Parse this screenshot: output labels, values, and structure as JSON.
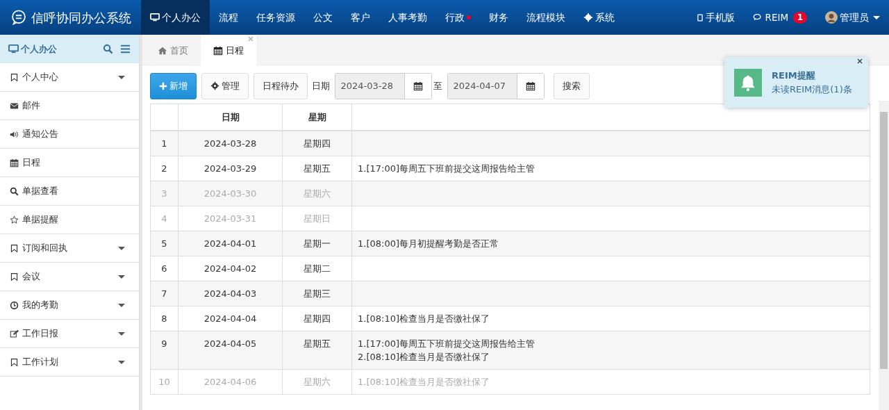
{
  "app": {
    "title": "信呼协同办公系统"
  },
  "top_nav": [
    {
      "label": "个人办公",
      "selected": true,
      "dot": false
    },
    {
      "label": "流程",
      "selected": false,
      "dot": false
    },
    {
      "label": "任务资源",
      "selected": false,
      "dot": false
    },
    {
      "label": "公文",
      "selected": false,
      "dot": false
    },
    {
      "label": "客户",
      "selected": false,
      "dot": false
    },
    {
      "label": "人事考勤",
      "selected": false,
      "dot": false
    },
    {
      "label": "行政",
      "selected": false,
      "dot": true
    },
    {
      "label": "财务",
      "selected": false,
      "dot": false
    },
    {
      "label": "流程模块",
      "selected": false,
      "dot": false
    },
    {
      "label": "系统",
      "selected": false,
      "dot": false
    }
  ],
  "top_right": {
    "mobile": "手机版",
    "reim": "REIM",
    "reim_badge": "1",
    "user": "管理员"
  },
  "sidebar": {
    "title": "个人办公",
    "items": [
      {
        "label": "个人中心",
        "expandable": true
      },
      {
        "label": "邮件",
        "expandable": false
      },
      {
        "label": "通知公告",
        "expandable": false
      },
      {
        "label": "日程",
        "expandable": false
      },
      {
        "label": "单据查看",
        "expandable": false
      },
      {
        "label": "单据提醒",
        "expandable": false
      },
      {
        "label": "订阅和回执",
        "expandable": true
      },
      {
        "label": "会议",
        "expandable": true
      },
      {
        "label": "我的考勤",
        "expandable": true
      },
      {
        "label": "工作日报",
        "expandable": true
      },
      {
        "label": "工作计划",
        "expandable": true
      }
    ]
  },
  "page_tabs": [
    {
      "label": "首页",
      "selected": false,
      "closable": false
    },
    {
      "label": "日程",
      "selected": true,
      "closable": true
    }
  ],
  "toolbar": {
    "add": "新增",
    "manage": "管理",
    "todo": "日程待办",
    "date_label": "日期",
    "date_from": "2024-03-28",
    "to_label": "至",
    "date_to": "2024-04-07",
    "search": "搜索"
  },
  "table": {
    "columns": [
      "日期",
      "星期"
    ],
    "rows": [
      {
        "index": "1",
        "date": "2024-03-28",
        "weekday": "星期四",
        "weekend": false,
        "events": []
      },
      {
        "index": "2",
        "date": "2024-03-29",
        "weekday": "星期五",
        "weekend": false,
        "events": [
          "1.[17:00]每周五下班前提交这周报告给主管"
        ]
      },
      {
        "index": "3",
        "date": "2024-03-30",
        "weekday": "星期六",
        "weekend": true,
        "events": []
      },
      {
        "index": "4",
        "date": "2024-03-31",
        "weekday": "星期日",
        "weekend": true,
        "events": []
      },
      {
        "index": "5",
        "date": "2024-04-01",
        "weekday": "星期一",
        "weekend": false,
        "events": [
          "1.[08:00]每月初提醒考勤是否正常"
        ]
      },
      {
        "index": "6",
        "date": "2024-04-02",
        "weekday": "星期二",
        "weekend": false,
        "events": []
      },
      {
        "index": "7",
        "date": "2024-04-03",
        "weekday": "星期三",
        "weekend": false,
        "events": []
      },
      {
        "index": "8",
        "date": "2024-04-04",
        "weekday": "星期四",
        "weekend": false,
        "events": [
          "1.[08:10]检查当月是否缴社保了"
        ]
      },
      {
        "index": "9",
        "date": "2024-04-05",
        "weekday": "星期五",
        "weekend": false,
        "events": [
          "1.[17:00]每周五下班前提交这周报告给主管",
          "2.[08:10]检查当月是否缴社保了"
        ]
      },
      {
        "index": "10",
        "date": "2024-04-06",
        "weekday": "星期六",
        "weekend": true,
        "events": [
          "1.[08:10]检查当月是否缴社保了"
        ]
      }
    ]
  },
  "notification": {
    "title": "REIM提醒",
    "message": "未读REIM消息(1)条"
  }
}
